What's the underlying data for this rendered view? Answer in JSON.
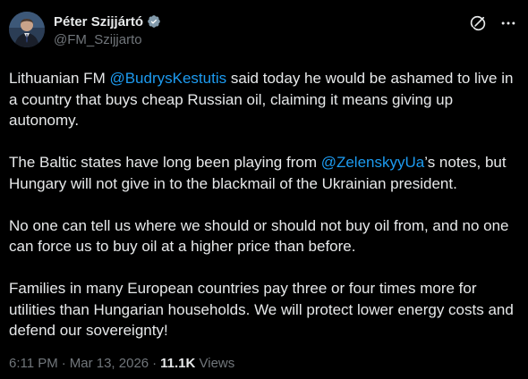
{
  "author": {
    "display_name": "Péter Szijjártó",
    "handle": "@FM_Szijjarto",
    "verified_color": "#829aab"
  },
  "actions": {
    "icons": [
      "grok-icon",
      "more-options-icon"
    ]
  },
  "tweet": {
    "p1": {
      "before": "Lithuanian FM ",
      "mention": "@BudrysKestutis",
      "after": " said today he would be ashamed to live in a country that buys cheap Russian oil, claiming it means giving up autonomy."
    },
    "p2": {
      "before": "The Baltic states have long been playing from ",
      "mention": "@ZelenskyyUa",
      "after": "’s notes, but Hungary will not give in to the blackmail of the Ukrainian president."
    },
    "p3": "No one can tell us where we should or should not buy oil from, and no one can force us to buy oil at a higher price than before.",
    "p4": "Families in many European countries pay three or four times more for utilities than Hungarian households. We will protect lower energy costs and defend our sovereignty!"
  },
  "meta": {
    "time": "6:11 PM",
    "separator": "·",
    "date": "Mar 13, 2026",
    "views_count": "11.1K",
    "views_label": "Views"
  },
  "colors": {
    "background": "#000000",
    "text": "#e7e9ea",
    "secondary": "#71767b",
    "link": "#1d9bf0"
  }
}
